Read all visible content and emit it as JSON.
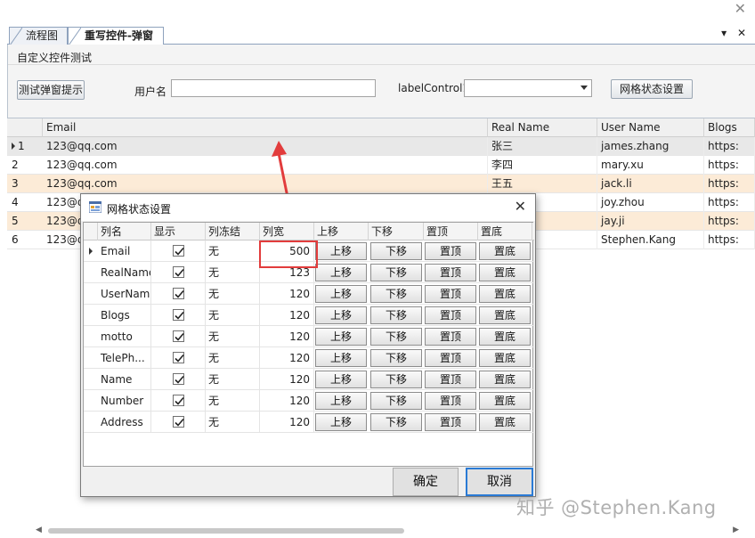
{
  "window": {
    "close_glyph": "✕"
  },
  "tabs": [
    {
      "label": "流程图"
    },
    {
      "label": "重写控件-弹窗类"
    }
  ],
  "tab_tools": {
    "dropdown": "▾",
    "close": "✕"
  },
  "panel": {
    "group_title": "自定义控件测试",
    "popup_button": "测试弹窗提示",
    "username_label": "用户名",
    "username_value": "",
    "label_control": "labelControl1",
    "combo_value": "",
    "grid_state_button": "网格状态设置"
  },
  "grid": {
    "columns": [
      "Email",
      "Real Name",
      "User Name",
      "Blogs"
    ],
    "rows": [
      {
        "n": "1",
        "email": "123@qq.com",
        "real": "张三",
        "user": "james.zhang",
        "blog": "https:"
      },
      {
        "n": "2",
        "email": "123@qq.com",
        "real": "李四",
        "user": "mary.xu",
        "blog": "https:"
      },
      {
        "n": "3",
        "email": "123@qq.com",
        "real": "王五",
        "user": "jack.li",
        "blog": "https:"
      },
      {
        "n": "4",
        "email": "123@qq",
        "real": "",
        "user": "joy.zhou",
        "blog": "https:"
      },
      {
        "n": "5",
        "email": "123@qq",
        "real": "",
        "user": "jay.ji",
        "blog": "https:"
      },
      {
        "n": "6",
        "email": "123@q",
        "real": "",
        "user": "Stephen.Kang",
        "blog": "https:"
      }
    ]
  },
  "dialog": {
    "title": "网格状态设置",
    "close_glyph": "✕",
    "headers": [
      "列名",
      "显示",
      "列冻结",
      "列宽",
      "上移",
      "下移",
      "置顶",
      "置底"
    ],
    "rows": [
      {
        "name": "Email",
        "visible": true,
        "freeze": "无",
        "width": "500"
      },
      {
        "name": "RealName",
        "visible": true,
        "freeze": "无",
        "width": "123"
      },
      {
        "name": "UserName",
        "visible": true,
        "freeze": "无",
        "width": "120"
      },
      {
        "name": "Blogs",
        "visible": true,
        "freeze": "无",
        "width": "120"
      },
      {
        "name": "motto",
        "visible": true,
        "freeze": "无",
        "width": "120"
      },
      {
        "name": "TelePh...",
        "visible": true,
        "freeze": "无",
        "width": "120"
      },
      {
        "name": "Name",
        "visible": true,
        "freeze": "无",
        "width": "120"
      },
      {
        "name": "Number",
        "visible": true,
        "freeze": "无",
        "width": "120"
      },
      {
        "name": "Address",
        "visible": true,
        "freeze": "无",
        "width": "120"
      }
    ],
    "row_buttons": {
      "up": "上移",
      "down": "下移",
      "top": "置顶",
      "bottom": "置底"
    },
    "ok": "确定",
    "cancel": "取消"
  },
  "watermark": "知乎 @Stephen.Kang",
  "colors": {
    "annotation_red": "#e23c3c",
    "primary_border": "#2a7ad5",
    "highlight_row": "#fcebd7"
  }
}
